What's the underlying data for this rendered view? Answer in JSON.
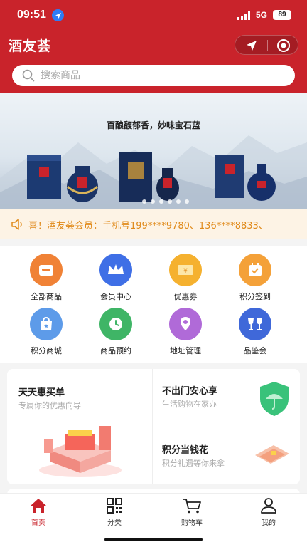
{
  "status_bar": {
    "time": "09:51",
    "network": "5G",
    "battery": "89"
  },
  "header": {
    "title": "酒友荟"
  },
  "search": {
    "placeholder": "搜索商品"
  },
  "banner": {
    "tagline": "百酿馥郁香，妙味宝石蓝",
    "slide_count": 6
  },
  "notice": {
    "text": "喜！酒友荟会员：手机号199****9780、136****8833、"
  },
  "menu": {
    "items": [
      {
        "label": "全部商品",
        "icon": "shop-icon",
        "color": "#f08236"
      },
      {
        "label": "会员中心",
        "icon": "crown-icon",
        "color": "#3f6fe6"
      },
      {
        "label": "优惠券",
        "icon": "coupon-icon",
        "color": "#f5b12f"
      },
      {
        "label": "积分签到",
        "icon": "calendar-check-icon",
        "color": "#f4a139"
      },
      {
        "label": "积分商城",
        "icon": "shopping-bag-icon",
        "color": "#5d9be9"
      },
      {
        "label": "商品预约",
        "icon": "clock-icon",
        "color": "#3fb566"
      },
      {
        "label": "地址管理",
        "icon": "map-pin-icon",
        "color": "#b06ad8"
      },
      {
        "label": "品鉴会",
        "icon": "glasses-icon",
        "color": "#3f68d9"
      }
    ]
  },
  "promo": {
    "left": {
      "title": "天天惠买单",
      "subtitle": "专属你的优惠向导"
    },
    "right_top": {
      "title": "不出门安心享",
      "subtitle": "生活购物在家办"
    },
    "right_bottom": {
      "title": "积分当钱花",
      "subtitle": "积分礼遇等你来拿"
    }
  },
  "tabbar": {
    "items": [
      {
        "label": "首页",
        "icon": "home-icon",
        "active": true
      },
      {
        "label": "分类",
        "icon": "qr-grid-icon",
        "active": false
      },
      {
        "label": "购物车",
        "icon": "cart-icon",
        "active": false
      },
      {
        "label": "我的",
        "icon": "user-icon",
        "active": false
      }
    ]
  },
  "colors": {
    "brand_red": "#c9232b",
    "notice_text": "#e08a1a",
    "notice_bg": "#fdf3e5"
  }
}
